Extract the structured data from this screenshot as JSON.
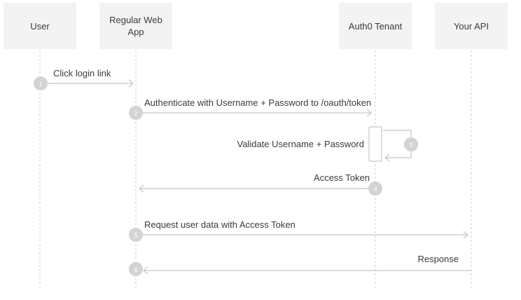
{
  "actors": {
    "user": "User",
    "webapp_line1": "Regular Web",
    "webapp_line2": "App",
    "auth0": "Auth0 Tenant",
    "api": "Your API"
  },
  "steps": [
    {
      "number": "1",
      "label": "Click login link",
      "from": "user",
      "to": "webapp"
    },
    {
      "number": "2",
      "label": "Authenticate with Username + Password to /oauth/token",
      "from": "webapp",
      "to": "auth0"
    },
    {
      "number": "3",
      "label": "Validate Username + Password",
      "from": "auth0",
      "to": "auth0"
    },
    {
      "number": "4",
      "label": "Access Token",
      "from": "auth0",
      "to": "webapp"
    },
    {
      "number": "5",
      "label": "Request user data with Access Token",
      "from": "webapp",
      "to": "api"
    },
    {
      "number": "6",
      "label": "Response",
      "from": "api",
      "to": "webapp"
    }
  ],
  "colors": {
    "actor_bg": "#f3f3f3",
    "line": "#c8c8c8",
    "badge": "#d3d3d3",
    "badge_text": "#ffffff",
    "text": "#3a3a3a"
  }
}
